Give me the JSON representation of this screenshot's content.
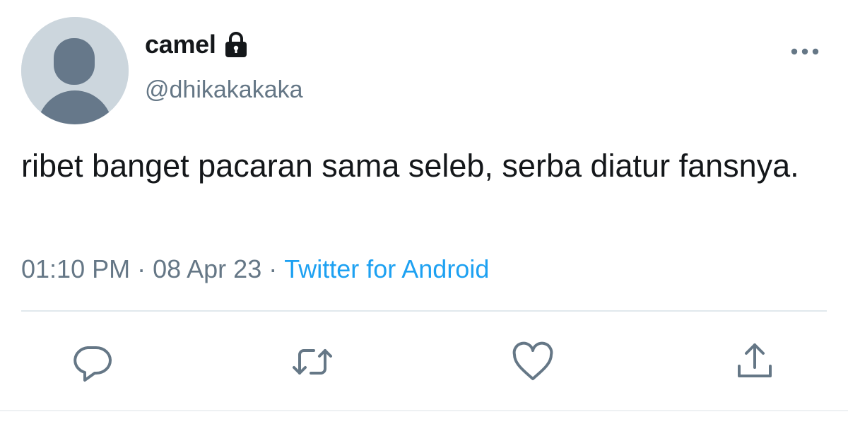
{
  "author": {
    "display_name": "camel",
    "handle": "@dhikakakaka",
    "protected_icon": "lock-icon",
    "avatar": "default-avatar"
  },
  "tweet": {
    "text": "ribet banget pacaran sama seleb, serba diatur fansnya.",
    "time": "01:10 PM",
    "separator": "·",
    "date": "08 Apr 23",
    "source": "Twitter for Android"
  },
  "actions": {
    "more": "more-icon",
    "reply": "reply-icon",
    "retweet": "retweet-icon",
    "like": "heart-icon",
    "share": "share-icon"
  },
  "colors": {
    "text": "#14171a",
    "secondary": "#657786",
    "link": "#1da1f2",
    "avatar_bg": "#ccd6dd",
    "avatar_fg": "#66788a",
    "divider": "#e1e8ed"
  }
}
